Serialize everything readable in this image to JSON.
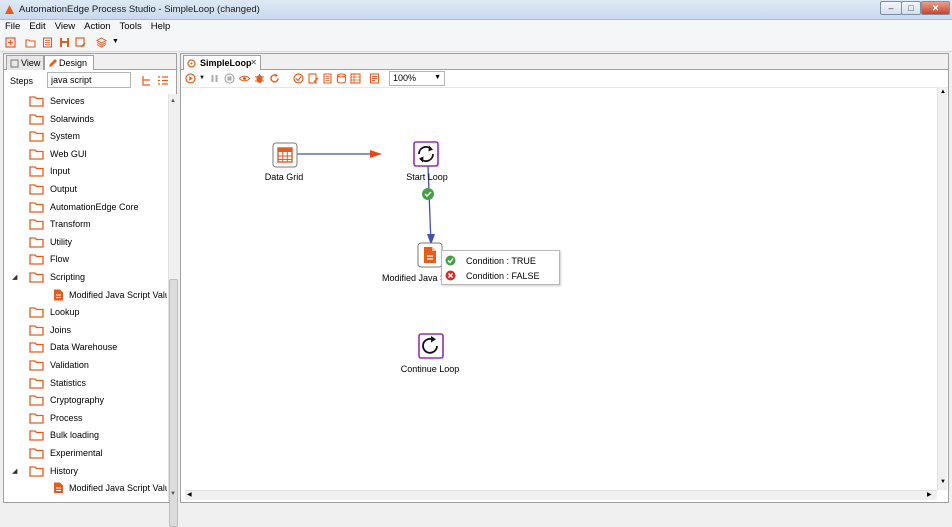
{
  "window": {
    "title": "AutomationEdge Process Studio - SimpleLoop (changed)",
    "minimize": "–",
    "maximize": "□",
    "close": "✕"
  },
  "menu": [
    "File",
    "Edit",
    "View",
    "Action",
    "Tools",
    "Help"
  ],
  "left_panel": {
    "tabs": [
      {
        "label": "View"
      },
      {
        "label": "Design"
      }
    ],
    "steps_label": "Steps",
    "search_value": "java script",
    "tree": [
      {
        "label": "Services",
        "expanded": false
      },
      {
        "label": "Solarwinds",
        "expanded": false
      },
      {
        "label": "System",
        "expanded": false
      },
      {
        "label": "Web GUI",
        "expanded": false
      },
      {
        "label": "Input",
        "expanded": false
      },
      {
        "label": "Output",
        "expanded": false
      },
      {
        "label": "AutomationEdge Core",
        "expanded": false
      },
      {
        "label": "Transform",
        "expanded": false
      },
      {
        "label": "Utility",
        "expanded": false
      },
      {
        "label": "Flow",
        "expanded": false
      },
      {
        "label": "Scripting",
        "expanded": true
      },
      {
        "label": "Modified Java Script Value",
        "child": true
      },
      {
        "label": "Lookup",
        "expanded": false
      },
      {
        "label": "Joins",
        "expanded": false
      },
      {
        "label": "Data Warehouse",
        "expanded": false
      },
      {
        "label": "Validation",
        "expanded": false
      },
      {
        "label": "Statistics",
        "expanded": false
      },
      {
        "label": "Cryptography",
        "expanded": false
      },
      {
        "label": "Process",
        "expanded": false
      },
      {
        "label": "Bulk loading",
        "expanded": false
      },
      {
        "label": "Experimental",
        "expanded": false
      },
      {
        "label": "History",
        "expanded": true
      },
      {
        "label": "Modified Java Script Value",
        "child": true
      }
    ]
  },
  "editor": {
    "tab_label": "SimpleLoop",
    "zoom": "100%",
    "nodes": {
      "data_grid": "Data Grid",
      "start_loop": "Start Loop",
      "modified_java": "Modified Java S",
      "continue_loop": "Continue Loop"
    },
    "popup": {
      "true_label": "Condition : TRUE",
      "false_label": "Condition : FALSE"
    }
  },
  "colors": {
    "accent": "#e65c1d",
    "hop_arrow": "#e8471a",
    "hop_line": "#3f51b5",
    "loop_purple": "#9b2bb5",
    "success": "#43a047",
    "error": "#d32f2f"
  }
}
